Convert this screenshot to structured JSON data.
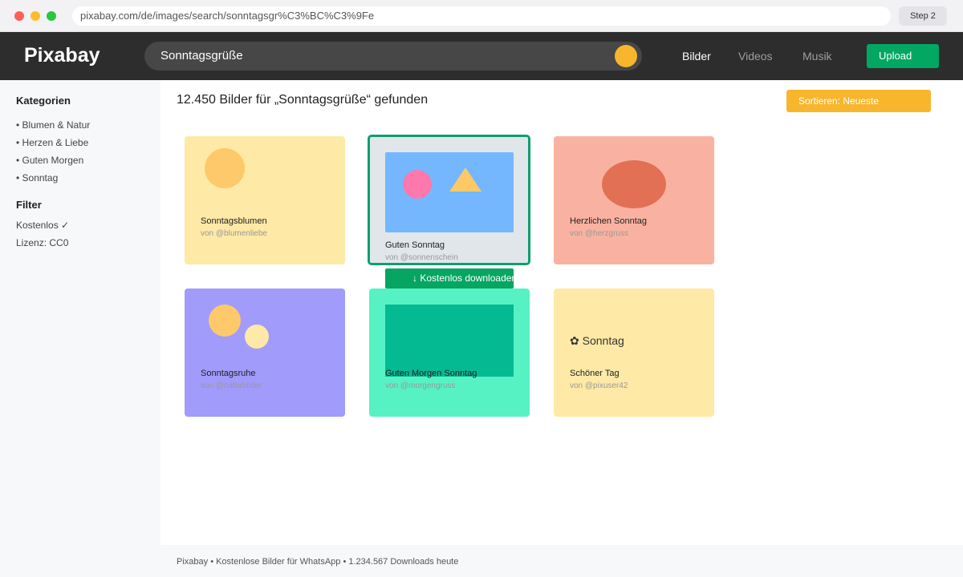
{
  "browser": {
    "url": "pixabay.com/de/images/search/sonntagsgr%C3%BC%C3%9Fe",
    "step_label": "Step 2"
  },
  "nav": {
    "logo": "Pixabay",
    "search_value": "Sonntagsgrüße",
    "links": [
      "Bilder",
      "Videos",
      "Musik"
    ],
    "active_link": "Bilder",
    "upload_label": "Upload"
  },
  "sidebar": {
    "categories_heading": "Kategorien",
    "categories": [
      "• Blumen & Natur",
      "• Herzen & Liebe",
      "• Guten Morgen",
      "• Sonntag"
    ],
    "filter_heading": "Filter",
    "filters": [
      "Kostenlos ✓",
      "Lizenz: CC0"
    ]
  },
  "main": {
    "result_title": "12.450 Bilder für „Sonntagsgrüße“ gefunden",
    "sort_label": "Sortieren: Neueste",
    "cards": [
      {
        "title": "Sonntagsblumen",
        "author": "von @blumenliebe"
      },
      {
        "title": "Guten Sonntag",
        "author": "von @sonnenschein"
      },
      {
        "title": "Herzlichen Sonntag",
        "author": "von @herzgruss"
      },
      {
        "title": "Sonntagsruhe",
        "author": "von @naturbilder"
      },
      {
        "title": "Guten Morgen Sonntag",
        "author": "von @morgengruss"
      },
      {
        "title": "Schöner Tag",
        "author": "von @pixuser42",
        "overlay_text": "Sonntag"
      }
    ],
    "download_label": "↓ Kostenlos downloaden"
  },
  "footer": {
    "text": "Pixabay • Kostenlose Bilder für WhatsApp • 1.234.567 Downloads heute"
  },
  "colors": {
    "nav_bg": "#2d2d2d",
    "brand_green": "#02a862",
    "accent_yellow": "#f8b62d",
    "card_yellow": "#fee9a6",
    "card_gray": "#e1e6ea",
    "card_coral": "#f9b2a1",
    "card_purple": "#a19bfc",
    "card_mint": "#57f2c4"
  },
  "icons": {
    "search_button": "search-icon",
    "overlay": "flower-icon"
  }
}
